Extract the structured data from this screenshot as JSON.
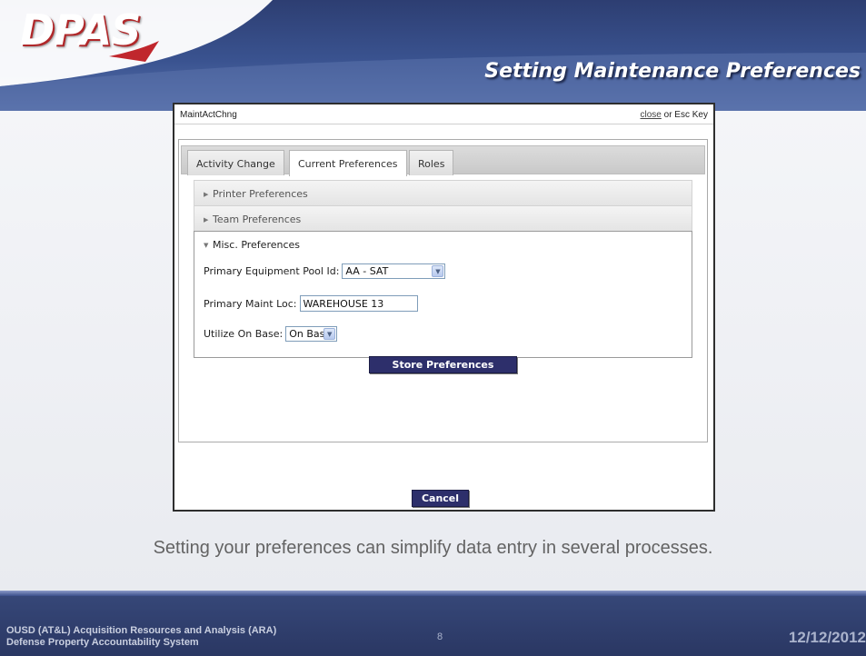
{
  "slide": {
    "logo": "DPAS",
    "title": "Setting Maintenance Preferences",
    "caption": "Setting your preferences can simplify data entry in several processes."
  },
  "dialog": {
    "title": "MaintActChng",
    "close_link": "close",
    "close_suffix": " or Esc Key",
    "tabs": [
      {
        "label": "Activity Change",
        "active": false
      },
      {
        "label": "Current Preferences",
        "active": true
      },
      {
        "label": "Roles",
        "active": false
      }
    ],
    "sections": [
      {
        "label": "Printer Preferences",
        "expanded": false
      },
      {
        "label": "Team Preferences",
        "expanded": false
      },
      {
        "label": "Misc. Preferences",
        "expanded": true
      }
    ],
    "misc": {
      "pool_label": "Primary Equipment Pool Id:",
      "pool_value": "AA - SAT",
      "loc_label": "Primary Maint Loc:",
      "loc_value": "WAREHOUSE 13",
      "base_label": "Utilize On Base:",
      "base_value": "On Base"
    },
    "store_button": "Store Preferences",
    "cancel_button": "Cancel"
  },
  "footer": {
    "line1": "OUSD (AT&L) Acquisition Resources and Analysis (ARA)",
    "line2": "Defense Property Accountability System",
    "page": "8",
    "date": "12/12/2012"
  },
  "colors": {
    "header_blue": "#2d3e72",
    "button_navy": "#2d2f6b",
    "logo_red_shadow": "#b0282a"
  }
}
